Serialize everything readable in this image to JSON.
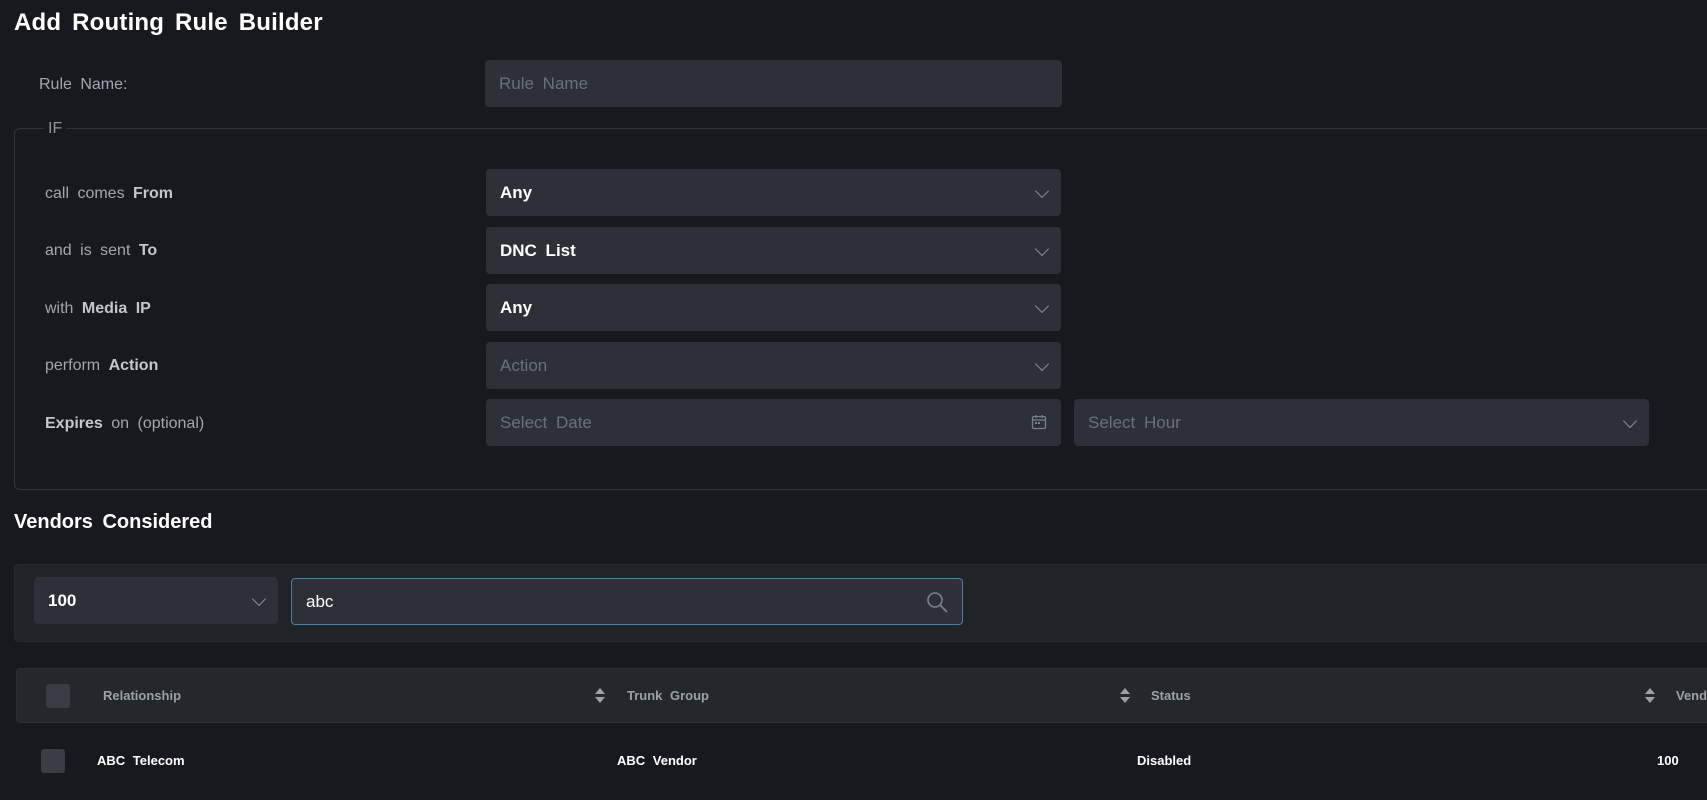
{
  "page": {
    "title": "Add Routing Rule Builder"
  },
  "rule_name": {
    "label": "Rule Name:",
    "placeholder": "Rule Name"
  },
  "if_section": {
    "legend": "IF",
    "rows": {
      "from": {
        "prefix": "call comes",
        "keyword": "From",
        "value": "Any"
      },
      "to": {
        "prefix": "and is sent",
        "keyword": "To",
        "value": "DNC List"
      },
      "media": {
        "prefix": "with",
        "keyword": "Media IP",
        "value": "Any"
      },
      "action": {
        "prefix": "perform",
        "keyword": "Action",
        "placeholder": "Action"
      },
      "expires": {
        "keyword": "Expires",
        "suffix": "on (optional)",
        "date_placeholder": "Select Date",
        "hour_placeholder": "Select Hour"
      }
    }
  },
  "vendors": {
    "title": "Vendors Considered",
    "page_size": "100",
    "search_value": "abc",
    "columns": [
      "Relationship",
      "Trunk Group",
      "Status",
      "Vend"
    ],
    "rows": [
      {
        "relationship": "ABC Telecom",
        "trunk_group": "ABC Vendor",
        "status": "Disabled",
        "vendor": "100"
      }
    ]
  },
  "icons": {
    "dropdown": "chevron-down-icon",
    "date": "calendar-icon",
    "search": "search-icon",
    "sort": "sort-icon"
  }
}
